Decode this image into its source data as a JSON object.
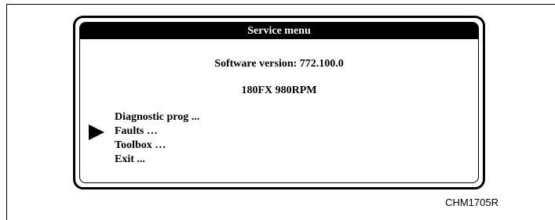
{
  "service_menu": {
    "title": "Service menu",
    "software_version": "Software version: 772.100.0",
    "model": "180FX 980RPM",
    "items": [
      {
        "label": "Diagnostic prog ..."
      },
      {
        "label": "Faults …",
        "selected": true
      },
      {
        "label": "Toolbox …"
      },
      {
        "label": "Exit ..."
      }
    ],
    "pointer_icon": "right-triangle-pointer"
  },
  "figure_code": "CHM1705R",
  "colors": {
    "background": "#ffffff",
    "foreground": "#000000",
    "title_bar": "#000000",
    "title_text": "#ffffff"
  }
}
